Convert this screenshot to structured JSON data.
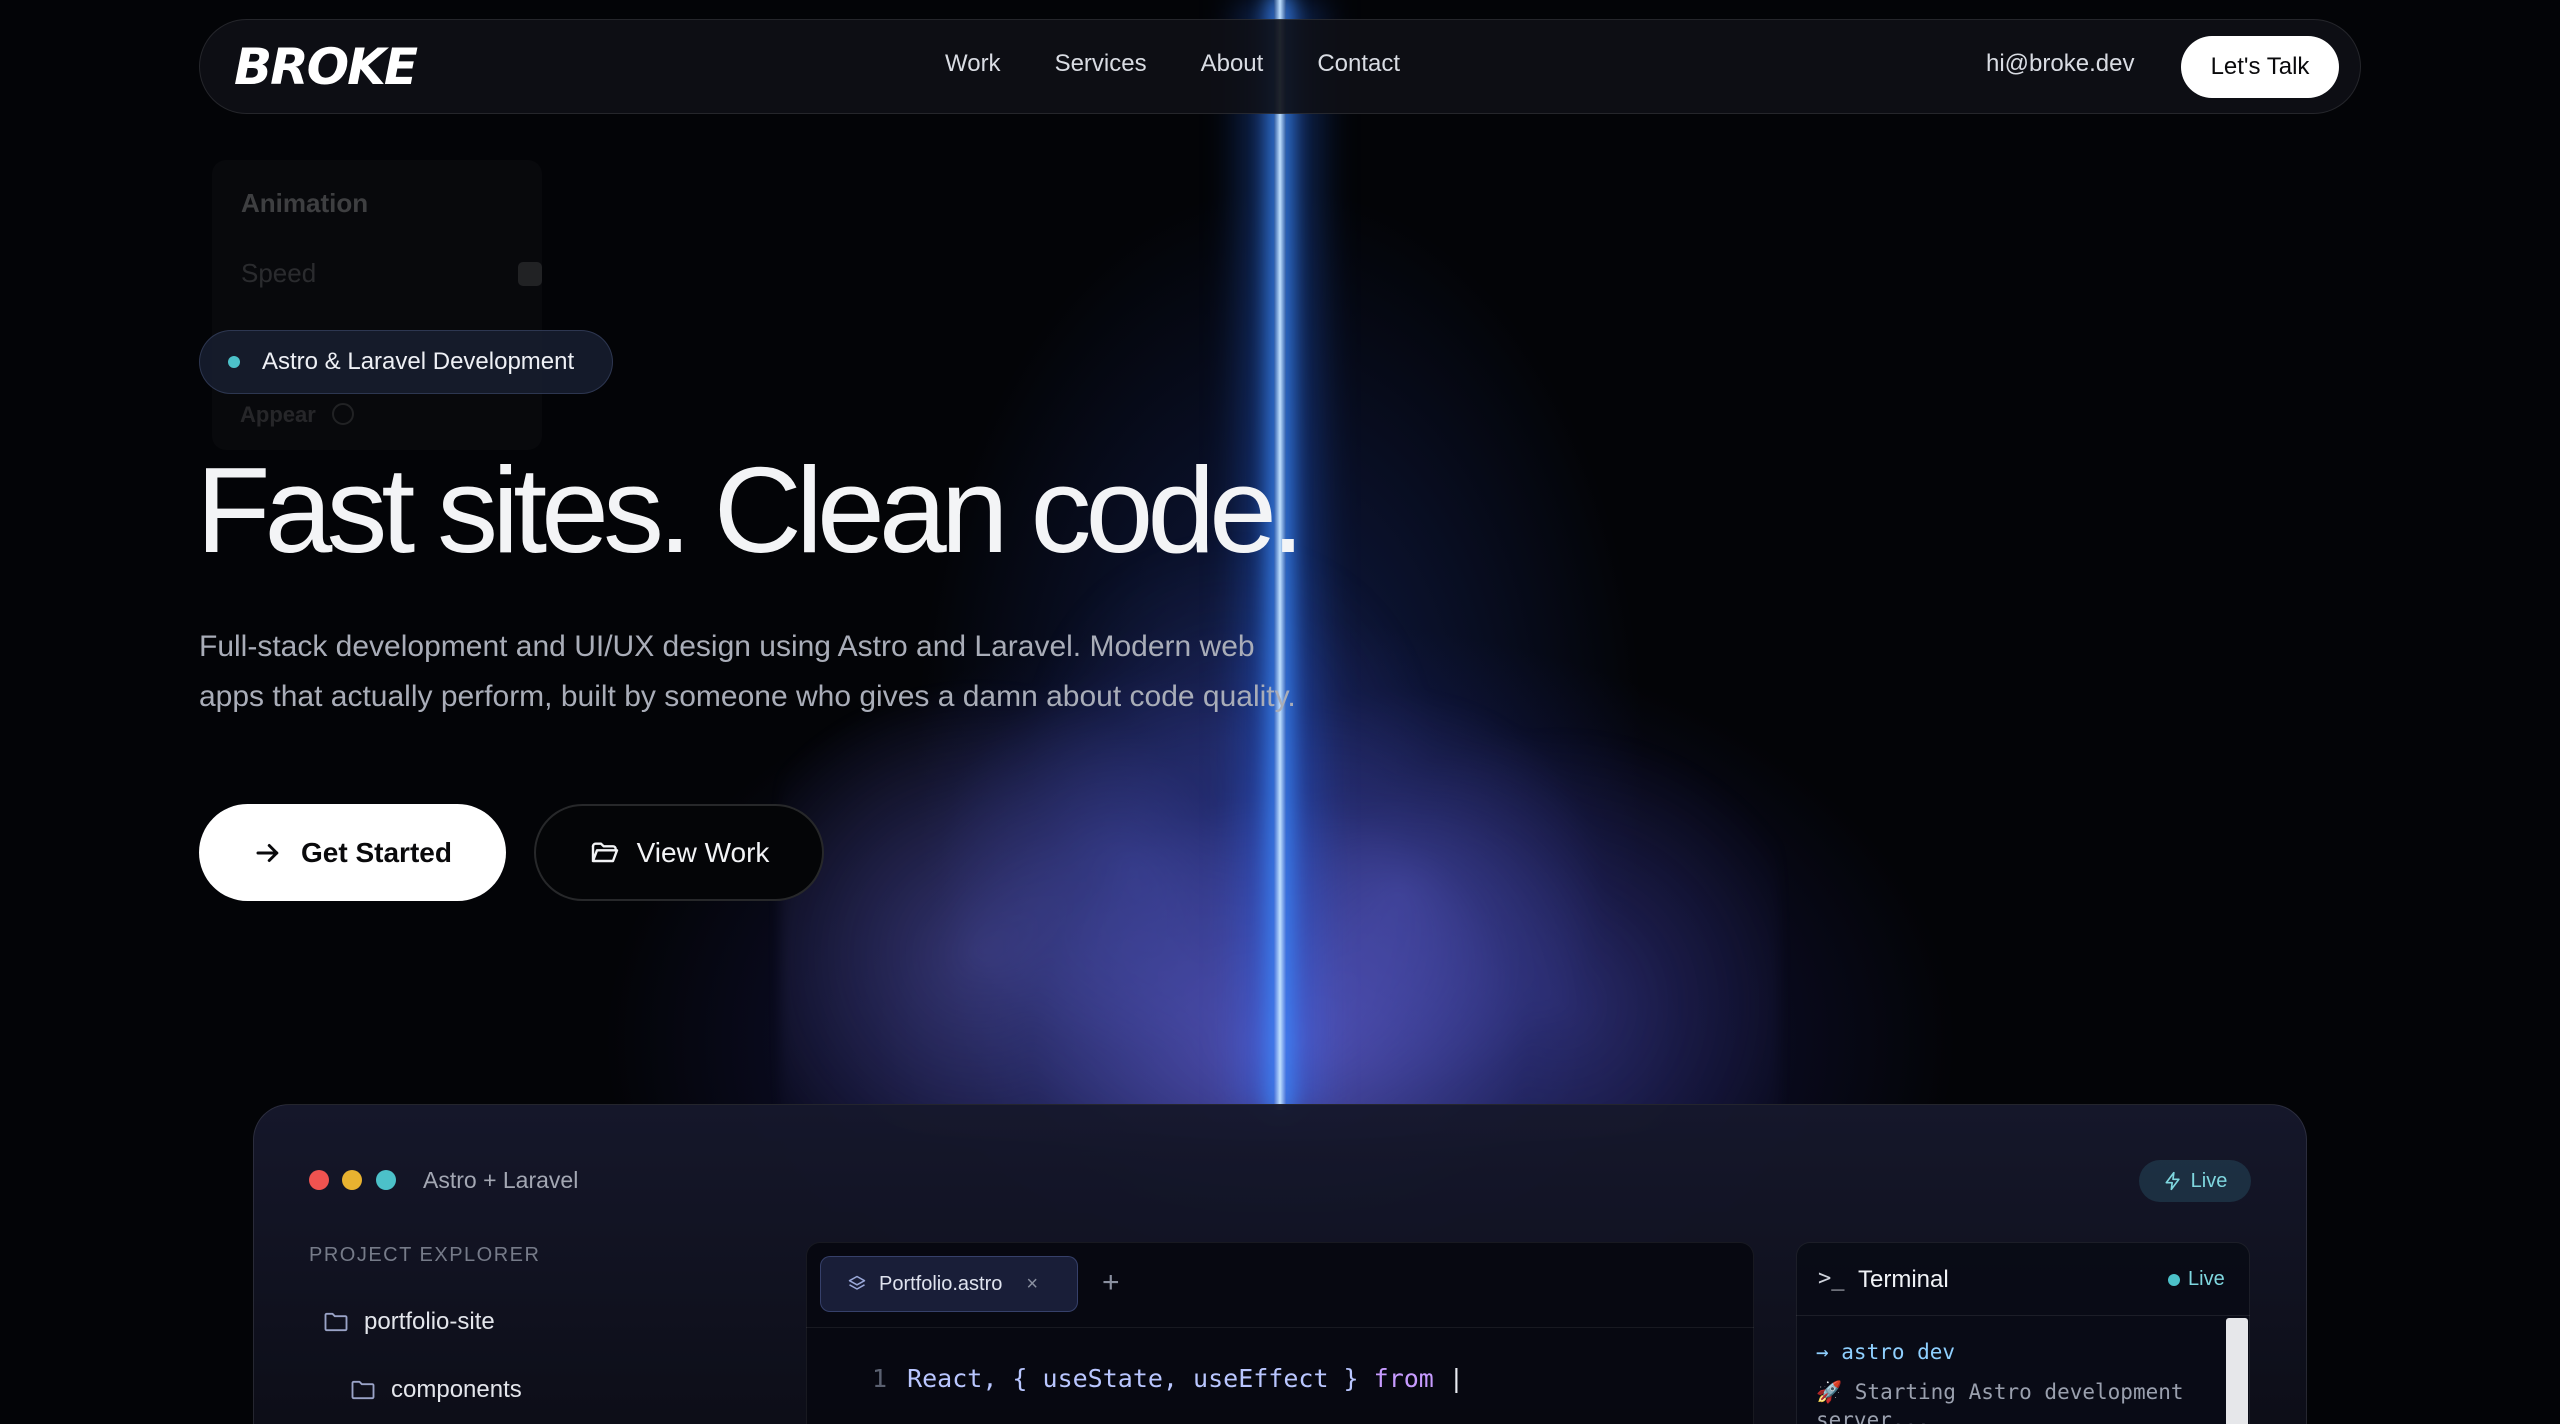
{
  "nav": {
    "logo": "BROKE",
    "links": [
      "Work",
      "Services",
      "About",
      "Contact"
    ],
    "email": "hi@broke.dev",
    "cta": "Let's Talk"
  },
  "ghost_panel": {
    "title": "Animation",
    "speed_label": "Speed",
    "appear_label": "Appear"
  },
  "hero": {
    "badge": "Astro & Laravel Development",
    "title": "Fast sites. Clean code.",
    "subtitle_line1": "Full-stack development and UI/UX design using Astro and Laravel. Modern web",
    "subtitle_line2": "apps that actually perform, built by someone who gives a damn about code quality.",
    "primary_button": "Get Started",
    "secondary_button": "View Work"
  },
  "window": {
    "title": "Astro + Laravel",
    "live_label": "Live",
    "explorer_label": "PROJECT EXPLORER",
    "tree": [
      "portfolio-site",
      "components"
    ],
    "editor_tab": "Portfolio.astro",
    "code": {
      "line_number": "1",
      "text": "React, { useState, useEffect } ",
      "keyword": "from",
      "cursor": " |"
    },
    "terminal": {
      "title": "Terminal",
      "live_label": "Live",
      "lines": [
        "→ astro dev",
        "🚀 Starting Astro development",
        "server..."
      ]
    }
  },
  "colors": {
    "accent_teal": "#4cc1c9",
    "beam_blue": "#3c8cff",
    "traffic_red": "#ef5350",
    "traffic_yellow": "#e8b230",
    "traffic_cyan": "#4cc1c9"
  }
}
